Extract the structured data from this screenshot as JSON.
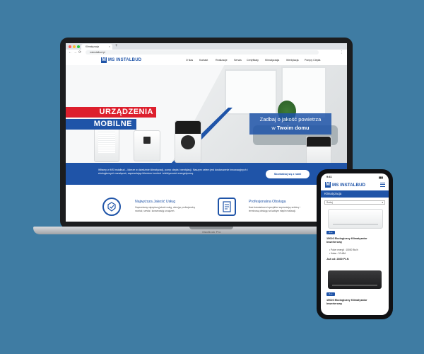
{
  "browser": {
    "tab_title": "Klimatyzacja",
    "url": "msinstalbud.pl",
    "new_tab_glyph": "+",
    "close_glyph": "×",
    "back_glyph": "←",
    "forward_glyph": "→",
    "reload_glyph": "⟳",
    "menu_glyph": "⋮"
  },
  "site": {
    "logo_mark": "M",
    "logo_text": "MS INSTALBUD",
    "nav": [
      "O Nas",
      "Kontakt",
      "Realizacje",
      "Serwis",
      "Certyfikaty",
      "Klimatyzacja",
      "Wentylacja",
      "Pompy Ciepła"
    ]
  },
  "hero": {
    "red_label": "URZĄDZENIA",
    "blue_label": "MOBILNE",
    "tagline_1": "Zadbaj o jakość powietrza",
    "tagline_2_prefix": "w ",
    "tagline_2_bold": "Twoim domu"
  },
  "info": {
    "text": "Witamy w MS Instalbud – liderze w dziedzinie klimatyzacji, pomp ciepła i wentylacji. Naszym celem jest dostarczenie innowacyjnych i ekologicznych rozwiązań, zapewniając klientom komfort i efektywność energetyczną.",
    "button": "Skontaktuj się z nami"
  },
  "features": [
    {
      "title": "Najwyższa Jakość Usług",
      "desc": "Zapewniamy najwyższą jakość usług, oferując profesjonalny montaż, serwis i konserwację urządzeń."
    },
    {
      "title": "Profesjonalna Obsługa",
      "desc": "Nasi doświadczeni specjaliści zapewniają rzetelną i terminową obsługę na każdym etapie realizacji."
    }
  ],
  "laptop": {
    "label": "MacBook Pro"
  },
  "phone": {
    "time": "9:41",
    "status": "▮▮▮",
    "logo_mark": "M",
    "logo_text": "MS INSTALBUD",
    "category": "Klimatyzacja",
    "sort_label": "Sortuj",
    "sort_arrow": "▾",
    "products": [
      {
        "badge": "A++",
        "name": "15026 Ekologiczny Klimatyzator Inwerterowy",
        "specs": [
          "• Poker energii : 15000 Btu/h",
          "• Hałas : 32 dBA"
        ],
        "price": "Już od: 2800 PLN"
      },
      {
        "badge": "A++",
        "name": "15026 Ekologiczny Klimatyzator Inwerterowy"
      }
    ]
  },
  "colors": {
    "background": "#3f7ca3",
    "brand_blue": "#1f54a8",
    "brand_red": "#dd1f2d"
  }
}
